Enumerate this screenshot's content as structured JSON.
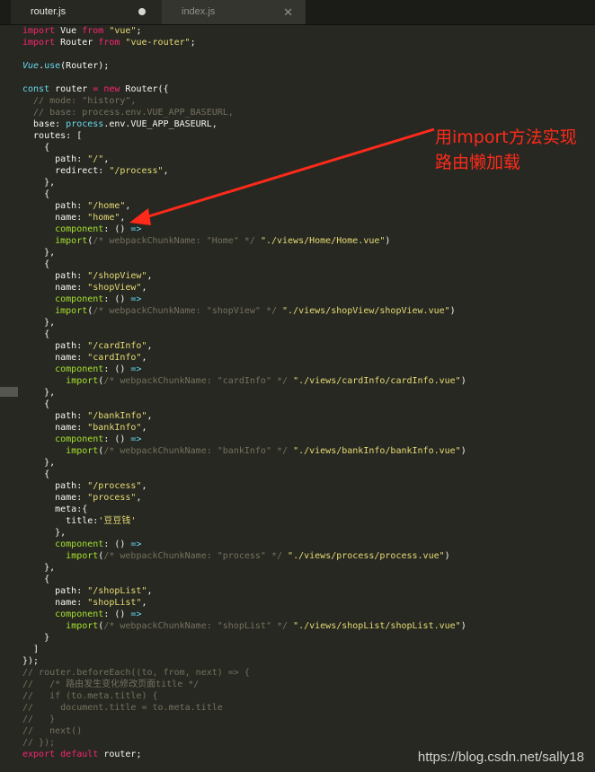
{
  "tabs": [
    {
      "label": "router.js",
      "active": true,
      "status_icon": "unsaved-dot-icon"
    },
    {
      "label": "index.js",
      "active": false,
      "status_icon": "close-icon"
    }
  ],
  "annotation": {
    "line1": "用import方法实现",
    "line2": "路由懒加载",
    "color": "#ff2a1a"
  },
  "watermark": "https://blog.csdn.net/sally18",
  "theme": {
    "background": "#272822",
    "keyword": "#f92672",
    "string": "#e6db74",
    "comment": "#75715e",
    "builtin": "#66d9ef",
    "function": "#a6e22e"
  },
  "code_lines": [
    [
      {
        "t": "k",
        "v": "import"
      },
      {
        "t": "n",
        "v": " Vue "
      },
      {
        "t": "k",
        "v": "from"
      },
      {
        "t": "n",
        "v": " "
      },
      {
        "t": "s",
        "v": "\"vue\""
      },
      {
        "t": "n",
        "v": ";"
      }
    ],
    [
      {
        "t": "k",
        "v": "import"
      },
      {
        "t": "n",
        "v": " Router "
      },
      {
        "t": "k",
        "v": "from"
      },
      {
        "t": "n",
        "v": " "
      },
      {
        "t": "s",
        "v": "\"vue-router\""
      },
      {
        "t": "n",
        "v": ";"
      }
    ],
    [],
    [
      {
        "t": "vs",
        "v": "Vue"
      },
      {
        "t": "n",
        "v": "."
      },
      {
        "t": "f",
        "v": "use"
      },
      {
        "t": "n",
        "v": "(Router);"
      }
    ],
    [],
    [
      {
        "t": "f",
        "v": "const"
      },
      {
        "t": "n",
        "v": " router "
      },
      {
        "t": "k",
        "v": "="
      },
      {
        "t": "n",
        "v": " "
      },
      {
        "t": "k",
        "v": "new"
      },
      {
        "t": "n",
        "v": " Router({"
      }
    ],
    [
      {
        "t": "c",
        "v": "  // mode: \"history\","
      }
    ],
    [
      {
        "t": "c",
        "v": "  // base: process.env.VUE_APP_BASEURL,"
      }
    ],
    [
      {
        "t": "n",
        "v": "  base: "
      },
      {
        "t": "f",
        "v": "process"
      },
      {
        "t": "n",
        "v": ".env.VUE_APP_BASEURL,"
      }
    ],
    [
      {
        "t": "n",
        "v": "  routes: ["
      }
    ],
    [
      {
        "t": "n",
        "v": "    {"
      }
    ],
    [
      {
        "t": "n",
        "v": "      path: "
      },
      {
        "t": "s",
        "v": "\"/\""
      },
      {
        "t": "n",
        "v": ","
      }
    ],
    [
      {
        "t": "n",
        "v": "      redirect: "
      },
      {
        "t": "s",
        "v": "\"/process\""
      },
      {
        "t": "n",
        "v": ","
      }
    ],
    [
      {
        "t": "n",
        "v": "    },"
      }
    ],
    [
      {
        "t": "n",
        "v": "    {"
      }
    ],
    [
      {
        "t": "n",
        "v": "      path: "
      },
      {
        "t": "s",
        "v": "\"/home\""
      },
      {
        "t": "n",
        "v": ","
      }
    ],
    [
      {
        "t": "n",
        "v": "      name: "
      },
      {
        "t": "s",
        "v": "\"home\""
      },
      {
        "t": "n",
        "v": ","
      }
    ],
    [
      {
        "t": "g",
        "v": "      component"
      },
      {
        "t": "n",
        "v": ": () "
      },
      {
        "t": "f",
        "v": "=>"
      }
    ],
    [
      {
        "t": "n",
        "v": "      "
      },
      {
        "t": "g",
        "v": "import"
      },
      {
        "t": "n",
        "v": "("
      },
      {
        "t": "c",
        "v": "/* webpackChunkName: \"Home\" */"
      },
      {
        "t": "n",
        "v": " "
      },
      {
        "t": "s",
        "v": "\"./views/Home/Home.vue\""
      },
      {
        "t": "n",
        "v": ")"
      }
    ],
    [
      {
        "t": "n",
        "v": "    },"
      }
    ],
    [
      {
        "t": "n",
        "v": "    {"
      }
    ],
    [
      {
        "t": "n",
        "v": "      path: "
      },
      {
        "t": "s",
        "v": "\"/shopView\""
      },
      {
        "t": "n",
        "v": ","
      }
    ],
    [
      {
        "t": "n",
        "v": "      name: "
      },
      {
        "t": "s",
        "v": "\"shopView\""
      },
      {
        "t": "n",
        "v": ","
      }
    ],
    [
      {
        "t": "g",
        "v": "      component"
      },
      {
        "t": "n",
        "v": ": () "
      },
      {
        "t": "f",
        "v": "=>"
      }
    ],
    [
      {
        "t": "n",
        "v": "      "
      },
      {
        "t": "g",
        "v": "import"
      },
      {
        "t": "n",
        "v": "("
      },
      {
        "t": "c",
        "v": "/* webpackChunkName: \"shopView\" */"
      },
      {
        "t": "n",
        "v": " "
      },
      {
        "t": "s",
        "v": "\"./views/shopView/shopView.vue\""
      },
      {
        "t": "n",
        "v": ")"
      }
    ],
    [
      {
        "t": "n",
        "v": "    },"
      }
    ],
    [
      {
        "t": "n",
        "v": "    {"
      }
    ],
    [
      {
        "t": "n",
        "v": "      path: "
      },
      {
        "t": "s",
        "v": "\"/cardInfo\""
      },
      {
        "t": "n",
        "v": ","
      }
    ],
    [
      {
        "t": "n",
        "v": "      name: "
      },
      {
        "t": "s",
        "v": "\"cardInfo\""
      },
      {
        "t": "n",
        "v": ","
      }
    ],
    [
      {
        "t": "g",
        "v": "      component"
      },
      {
        "t": "n",
        "v": ": () "
      },
      {
        "t": "f",
        "v": "=>"
      }
    ],
    [
      {
        "t": "n",
        "v": "        "
      },
      {
        "t": "g",
        "v": "import"
      },
      {
        "t": "n",
        "v": "("
      },
      {
        "t": "c",
        "v": "/* webpackChunkName: \"cardInfo\" */"
      },
      {
        "t": "n",
        "v": " "
      },
      {
        "t": "s",
        "v": "\"./views/cardInfo/cardInfo.vue\""
      },
      {
        "t": "n",
        "v": ")"
      }
    ],
    [
      {
        "t": "n",
        "v": "    },"
      }
    ],
    [
      {
        "t": "n",
        "v": "    {"
      }
    ],
    [
      {
        "t": "n",
        "v": "      path: "
      },
      {
        "t": "s",
        "v": "\"/bankInfo\""
      },
      {
        "t": "n",
        "v": ","
      }
    ],
    [
      {
        "t": "n",
        "v": "      name: "
      },
      {
        "t": "s",
        "v": "\"bankInfo\""
      },
      {
        "t": "n",
        "v": ","
      }
    ],
    [
      {
        "t": "g",
        "v": "      component"
      },
      {
        "t": "n",
        "v": ": () "
      },
      {
        "t": "f",
        "v": "=>"
      }
    ],
    [
      {
        "t": "n",
        "v": "        "
      },
      {
        "t": "g",
        "v": "import"
      },
      {
        "t": "n",
        "v": "("
      },
      {
        "t": "c",
        "v": "/* webpackChunkName: \"bankInfo\" */"
      },
      {
        "t": "n",
        "v": " "
      },
      {
        "t": "s",
        "v": "\"./views/bankInfo/bankInfo.vue\""
      },
      {
        "t": "n",
        "v": ")"
      }
    ],
    [
      {
        "t": "n",
        "v": "    },"
      }
    ],
    [
      {
        "t": "n",
        "v": "    {"
      }
    ],
    [
      {
        "t": "n",
        "v": "      path: "
      },
      {
        "t": "s",
        "v": "\"/process\""
      },
      {
        "t": "n",
        "v": ","
      }
    ],
    [
      {
        "t": "n",
        "v": "      name: "
      },
      {
        "t": "s",
        "v": "\"process\""
      },
      {
        "t": "n",
        "v": ","
      }
    ],
    [
      {
        "t": "n",
        "v": "      meta:{"
      }
    ],
    [
      {
        "t": "n",
        "v": "        title:"
      },
      {
        "t": "s",
        "v": "'豆豆钱'"
      }
    ],
    [
      {
        "t": "n",
        "v": "      },"
      }
    ],
    [
      {
        "t": "g",
        "v": "      component"
      },
      {
        "t": "n",
        "v": ": () "
      },
      {
        "t": "f",
        "v": "=>"
      }
    ],
    [
      {
        "t": "n",
        "v": "        "
      },
      {
        "t": "g",
        "v": "import"
      },
      {
        "t": "n",
        "v": "("
      },
      {
        "t": "c",
        "v": "/* webpackChunkName: \"process\" */"
      },
      {
        "t": "n",
        "v": " "
      },
      {
        "t": "s",
        "v": "\"./views/process/process.vue\""
      },
      {
        "t": "n",
        "v": ")"
      }
    ],
    [
      {
        "t": "n",
        "v": "    },"
      }
    ],
    [
      {
        "t": "n",
        "v": "    {"
      }
    ],
    [
      {
        "t": "n",
        "v": "      path: "
      },
      {
        "t": "s",
        "v": "\"/shopList\""
      },
      {
        "t": "n",
        "v": ","
      }
    ],
    [
      {
        "t": "n",
        "v": "      name: "
      },
      {
        "t": "s",
        "v": "\"shopList\""
      },
      {
        "t": "n",
        "v": ","
      }
    ],
    [
      {
        "t": "g",
        "v": "      component"
      },
      {
        "t": "n",
        "v": ": () "
      },
      {
        "t": "f",
        "v": "=>"
      }
    ],
    [
      {
        "t": "n",
        "v": "        "
      },
      {
        "t": "g",
        "v": "import"
      },
      {
        "t": "n",
        "v": "("
      },
      {
        "t": "c",
        "v": "/* webpackChunkName: \"shopList\" */"
      },
      {
        "t": "n",
        "v": " "
      },
      {
        "t": "s",
        "v": "\"./views/shopList/shopList.vue\""
      },
      {
        "t": "n",
        "v": ")"
      }
    ],
    [
      {
        "t": "n",
        "v": "    }"
      }
    ],
    [
      {
        "t": "n",
        "v": "  ]"
      }
    ],
    [
      {
        "t": "n",
        "v": "});"
      }
    ],
    [
      {
        "t": "c",
        "v": "// router.beforeEach((to, from, next) => {"
      }
    ],
    [
      {
        "t": "c",
        "v": "//   /* 路由发生变化修改页面title */"
      }
    ],
    [
      {
        "t": "c",
        "v": "//   if (to.meta.title) {"
      }
    ],
    [
      {
        "t": "c",
        "v": "//     document.title = to.meta.title"
      }
    ],
    [
      {
        "t": "c",
        "v": "//   }"
      }
    ],
    [
      {
        "t": "c",
        "v": "//   next()"
      }
    ],
    [
      {
        "t": "c",
        "v": "// });"
      }
    ],
    [
      {
        "t": "k",
        "v": "export"
      },
      {
        "t": "n",
        "v": " "
      },
      {
        "t": "k",
        "v": "default"
      },
      {
        "t": "n",
        "v": " router;"
      }
    ]
  ]
}
